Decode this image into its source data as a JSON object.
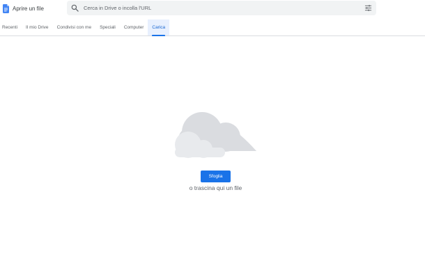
{
  "header": {
    "title": "Aprire un file",
    "app_icon": "docs-file-icon",
    "search": {
      "placeholder": "Cerca in Drive o incolla l'URL",
      "value": "",
      "icon": "search-icon",
      "options_icon": "tune-icon"
    }
  },
  "tabs": [
    {
      "label": "Recenti",
      "active": false
    },
    {
      "label": "Il mio Drive",
      "active": false
    },
    {
      "label": "Condivisi con me",
      "active": false
    },
    {
      "label": "Speciali",
      "active": false
    },
    {
      "label": "Computer",
      "active": false
    },
    {
      "label": "Carica",
      "active": true
    }
  ],
  "upload": {
    "illustration": "cloud-icon",
    "browse_label": "Sfoglia",
    "drop_text": "o trascina qui un file"
  },
  "colors": {
    "accent": "#1a73e8",
    "active_tab_bg": "#e8f0fe",
    "doc_icon": "#4285f4",
    "cloud_back": "#dadce0",
    "cloud_front": "#e8eaed"
  }
}
